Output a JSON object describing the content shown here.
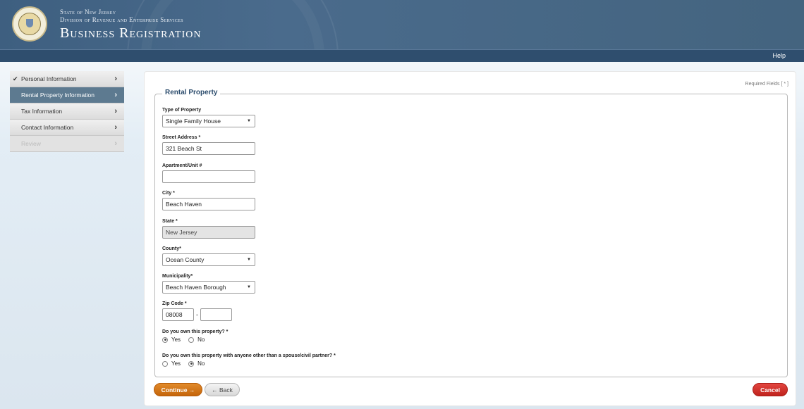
{
  "header": {
    "state_line": "State of New Jersey",
    "division_line": "Division of Revenue and Enterprise Services",
    "app_title": "Business Registration",
    "help_label": "Help"
  },
  "sidebar": {
    "items": [
      {
        "label": "Personal Information",
        "state": "completed"
      },
      {
        "label": "Rental Property Information",
        "state": "active"
      },
      {
        "label": "Tax Information",
        "state": "normal"
      },
      {
        "label": "Contact Information",
        "state": "normal"
      },
      {
        "label": "Review",
        "state": "disabled"
      }
    ]
  },
  "form": {
    "required_note": "Required Fields [ * ]",
    "legend": "Rental Property",
    "type_of_property": {
      "label": "Type of Property",
      "value": "Single Family House"
    },
    "street_address": {
      "label": "Street Address *",
      "value": "321 Beach St"
    },
    "apartment": {
      "label": "Apartment/Unit #",
      "value": ""
    },
    "city": {
      "label": "City *",
      "value": "Beach Haven"
    },
    "state": {
      "label": "State *",
      "value": "New Jersey"
    },
    "county": {
      "label": "County*",
      "value": "Ocean County"
    },
    "municipality": {
      "label": "Municipality*",
      "value": "Beach Haven Borough"
    },
    "zip": {
      "label": "Zip Code *",
      "value": "08008",
      "separator": "-",
      "ext_value": ""
    },
    "own_property": {
      "question": "Do you own this property? *",
      "yes": "Yes",
      "no": "No",
      "selected": "Yes"
    },
    "own_with_other": {
      "question": "Do you own this property with anyone other than a spouse/civil partner? *",
      "yes": "Yes",
      "no": "No",
      "selected": "No"
    }
  },
  "buttons": {
    "continue": "Continue →",
    "back": "← Back",
    "cancel": "Cancel"
  },
  "colors": {
    "header_bg": "#3e5f80",
    "navbar_bg": "#2f4e6e",
    "continue_btn": "#d6761a",
    "cancel_btn": "#d0322c",
    "active_sidebar": "#5d7a90"
  }
}
